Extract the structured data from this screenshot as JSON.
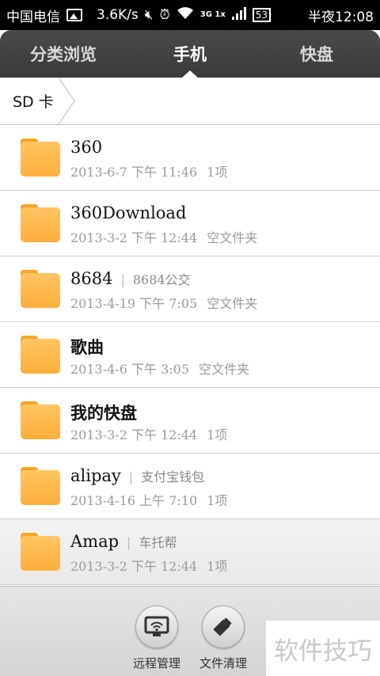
{
  "status_bar": {
    "carrier": "中国电信",
    "speed": "3.6K/s",
    "network": "3G 1x",
    "battery": "53",
    "time": "半夜12:08"
  },
  "tabs": [
    {
      "label": "分类浏览",
      "active": false
    },
    {
      "label": "手机",
      "active": true
    },
    {
      "label": "快盘",
      "active": false
    }
  ],
  "breadcrumb": {
    "label": "SD 卡"
  },
  "files": [
    {
      "name": "360",
      "desc": "",
      "date": "2013-6-7 下午 11:46",
      "info": "1项"
    },
    {
      "name": "360Download",
      "desc": "",
      "date": "2013-3-2 下午 12:44",
      "info": "空文件夹"
    },
    {
      "name": "8684",
      "desc": "8684公交",
      "date": "2013-4-19 下午 7:05",
      "info": "空文件夹"
    },
    {
      "name": "歌曲",
      "desc": "",
      "date": "2013-4-6 下午 3:05",
      "info": "空文件夹"
    },
    {
      "name": "我的快盘",
      "desc": "",
      "date": "2013-3-2 下午 12:44",
      "info": "1项"
    },
    {
      "name": "alipay",
      "desc": "支付宝钱包",
      "date": "2013-4-16 上午 7:10",
      "info": "1项"
    },
    {
      "name": "Amap",
      "desc": "车托帮",
      "date": "2013-3-2 下午 12:44",
      "info": "1项"
    }
  ],
  "bottom_actions": [
    {
      "label": "远程管理",
      "icon": "monitor-wifi-icon"
    },
    {
      "label": "文件清理",
      "icon": "brush-icon"
    }
  ],
  "watermark": "软件技巧"
}
